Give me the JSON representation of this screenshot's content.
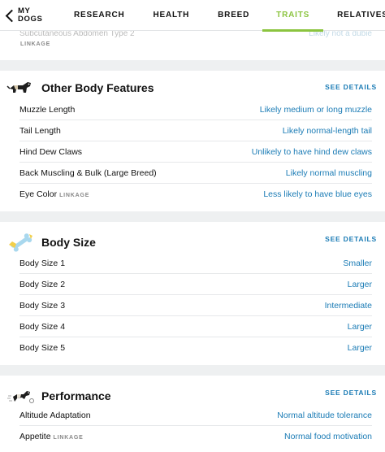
{
  "nav": {
    "back_line1": "MY",
    "back_line2": "DOGS",
    "tabs": [
      "RESEARCH",
      "HEALTH",
      "BREED",
      "TRAITS",
      "RELATIVES"
    ],
    "active_tab": "TRAITS",
    "accent_color": "#8bc43f"
  },
  "cutoff": {
    "title": "Subcutaneous Abdomen Type 2",
    "value": "Likely not a dubie",
    "tag": "LINKAGE"
  },
  "sections": [
    {
      "title": "Other Body Features",
      "icon": "dog-silhouette-icon",
      "see_details": "SEE DETAILS",
      "rows": [
        {
          "label": "Muzzle Length",
          "tag": "",
          "value": "Likely medium or long muzzle"
        },
        {
          "label": "Tail Length",
          "tag": "",
          "value": "Likely normal-length tail"
        },
        {
          "label": "Hind Dew Claws",
          "tag": "",
          "value": "Unlikely to have hind dew claws"
        },
        {
          "label": "Back Muscling & Bulk (Large Breed)",
          "tag": "",
          "value": "Likely normal muscling"
        },
        {
          "label": "Eye Color",
          "tag": "LINKAGE",
          "value": "Less likely to have blue eyes"
        }
      ]
    },
    {
      "title": "Body Size",
      "icon": "bone-icon",
      "see_details": "SEE DETAILS",
      "rows": [
        {
          "label": "Body Size 1",
          "tag": "",
          "value": "Smaller"
        },
        {
          "label": "Body Size 2",
          "tag": "",
          "value": "Larger"
        },
        {
          "label": "Body Size 3",
          "tag": "",
          "value": "Intermediate"
        },
        {
          "label": "Body Size 4",
          "tag": "",
          "value": "Larger"
        },
        {
          "label": "Body Size 5",
          "tag": "",
          "value": "Larger"
        }
      ]
    },
    {
      "title": "Performance",
      "icon": "running-dog-icon",
      "see_details": "SEE DETAILS",
      "rows": [
        {
          "label": "Altitude Adaptation",
          "tag": "",
          "value": "Normal altitude tolerance"
        },
        {
          "label": "Appetite",
          "tag": "LINKAGE",
          "value": "Normal food motivation"
        }
      ]
    }
  ],
  "colors": {
    "link": "#1a7bb5",
    "background": "#eef0f1"
  }
}
